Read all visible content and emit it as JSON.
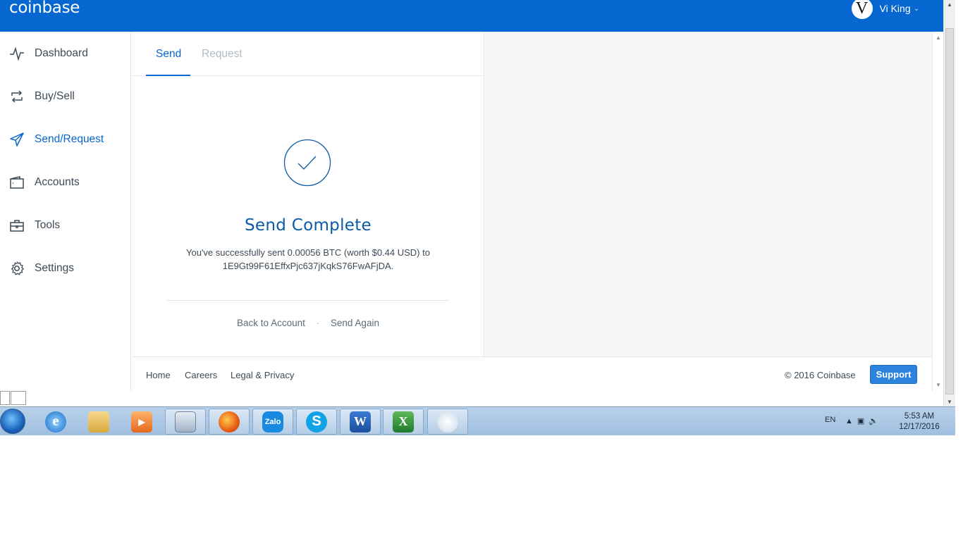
{
  "header": {
    "logo": "coinbase",
    "avatar_letter": "V",
    "user_name": "Vi King"
  },
  "sidebar": {
    "items": [
      {
        "label": "Dashboard",
        "icon": "pulse-icon"
      },
      {
        "label": "Buy/Sell",
        "icon": "exchange-icon"
      },
      {
        "label": "Send/Request",
        "icon": "paper-plane-icon"
      },
      {
        "label": "Accounts",
        "icon": "wallet-icon"
      },
      {
        "label": "Tools",
        "icon": "toolbox-icon"
      },
      {
        "label": "Settings",
        "icon": "gear-icon"
      }
    ],
    "active": "Send/Request"
  },
  "tabs": {
    "send": "Send",
    "request": "Request",
    "active": "Send"
  },
  "result": {
    "title": "Send Complete",
    "message_line1": "You've successfully sent 0.00056 BTC (worth $0.44 USD) to",
    "message_line2": "1E9Gt99F61EffxPjc637jKqkS76FwAFjDA.",
    "back_link": "Back to Account",
    "separator": "·",
    "again_link": "Send Again"
  },
  "footer": {
    "home": "Home",
    "careers": "Careers",
    "legal": "Legal & Privacy",
    "copyright": "© 2016 Coinbase",
    "support": "Support"
  },
  "taskbar": {
    "language": "EN",
    "time": "5:53 AM",
    "date": "12/17/2016",
    "apps": [
      "internet-explorer-icon",
      "file-explorer-icon",
      "media-player-icon",
      "calculator-icon",
      "firefox-icon",
      "zalo-icon",
      "skype-icon",
      "word-icon",
      "excel-icon",
      "paint-icon"
    ],
    "zalo_label": "Zalo"
  },
  "colors": {
    "brand": "#0667d0",
    "title": "#0b5aa8",
    "support_button": "#2c83de"
  }
}
